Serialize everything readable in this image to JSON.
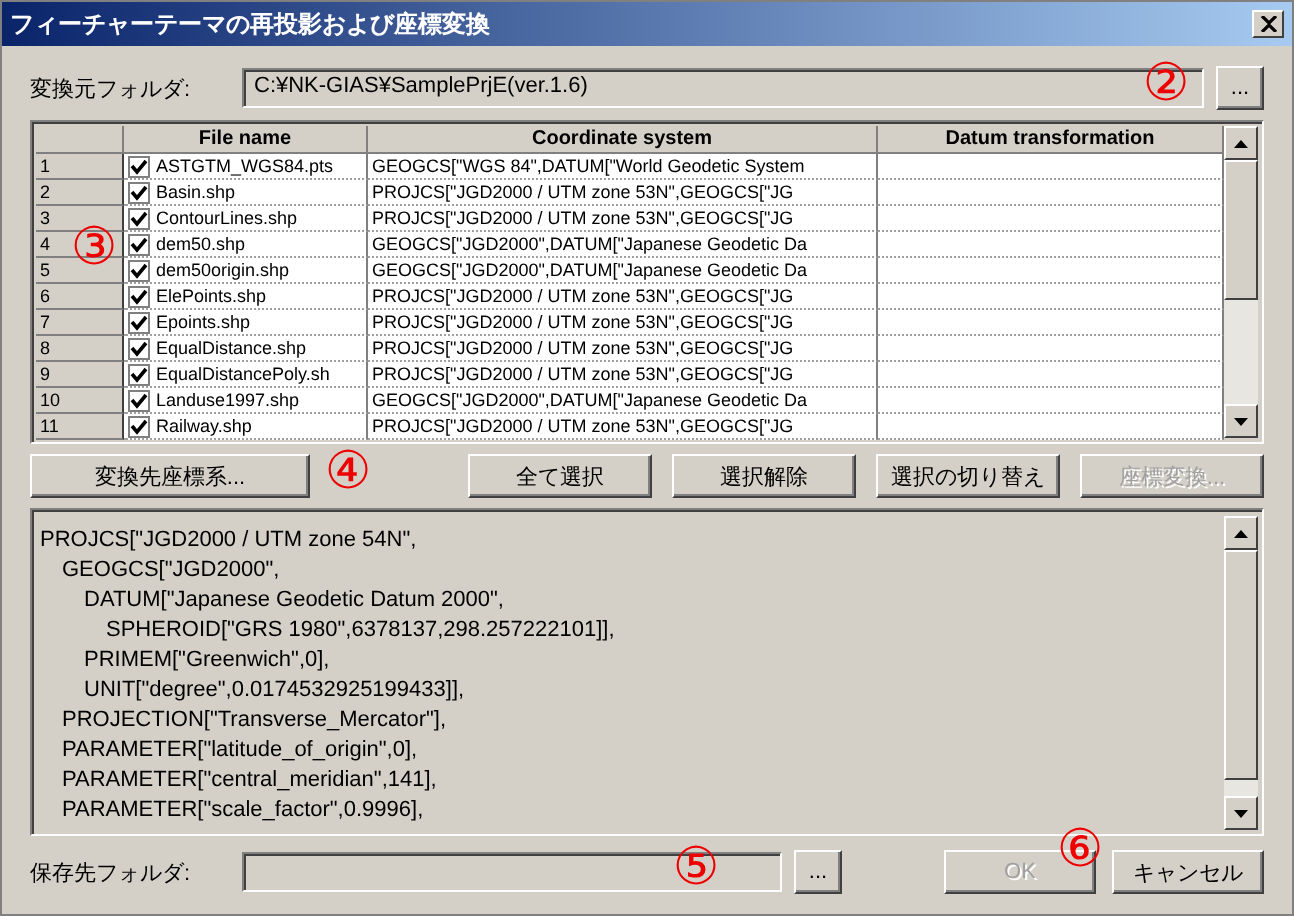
{
  "window": {
    "title": "フィーチャーテーマの再投影および座標変換"
  },
  "source_folder": {
    "label": "変換元フォルダ:",
    "value": "C:¥NK-GIAS¥SamplePrjE(ver.1.6)",
    "browse": "...",
    "callout": "②"
  },
  "table": {
    "callout": "③",
    "columns": [
      "File name",
      "Coordinate system",
      "Datum transformation"
    ],
    "rows": [
      {
        "number": "1",
        "checked": true,
        "file": "ASTGTM_WGS84.pts",
        "coord": "GEOGCS[\"WGS 84\",DATUM[\"World Geodetic System"
      },
      {
        "number": "2",
        "checked": true,
        "file": "Basin.shp",
        "coord": "PROJCS[\"JGD2000 / UTM zone 53N\",GEOGCS[\"JG"
      },
      {
        "number": "3",
        "checked": true,
        "file": "ContourLines.shp",
        "coord": "PROJCS[\"JGD2000 / UTM zone 53N\",GEOGCS[\"JG"
      },
      {
        "number": "4",
        "checked": true,
        "file": "dem50.shp",
        "coord": "GEOGCS[\"JGD2000\",DATUM[\"Japanese Geodetic Da"
      },
      {
        "number": "5",
        "checked": true,
        "file": "dem50origin.shp",
        "coord": "GEOGCS[\"JGD2000\",DATUM[\"Japanese Geodetic Da"
      },
      {
        "number": "6",
        "checked": true,
        "file": "ElePoints.shp",
        "coord": "PROJCS[\"JGD2000 / UTM zone 53N\",GEOGCS[\"JG"
      },
      {
        "number": "7",
        "checked": true,
        "file": "Epoints.shp",
        "coord": "PROJCS[\"JGD2000 / UTM zone 53N\",GEOGCS[\"JG"
      },
      {
        "number": "8",
        "checked": true,
        "file": "EqualDistance.shp",
        "coord": "PROJCS[\"JGD2000 / UTM zone 53N\",GEOGCS[\"JG"
      },
      {
        "number": "9",
        "checked": true,
        "file": "EqualDistancePoly.sh",
        "coord": "PROJCS[\"JGD2000 / UTM zone 53N\",GEOGCS[\"JG"
      },
      {
        "number": "10",
        "checked": true,
        "file": "Landuse1997.shp",
        "coord": "GEOGCS[\"JGD2000\",DATUM[\"Japanese Geodetic Da"
      },
      {
        "number": "11",
        "checked": true,
        "file": "Railway.shp",
        "coord": "PROJCS[\"JGD2000 / UTM zone 53N\",GEOGCS[\"JG"
      }
    ]
  },
  "buttons": {
    "callout": "④",
    "items": [
      {
        "label": "変換先座標系...",
        "disabled": false
      },
      {
        "label": "全て選択",
        "disabled": false
      },
      {
        "label": "選択解除",
        "disabled": false
      },
      {
        "label": "選択の切り替え",
        "disabled": false
      },
      {
        "label": "座標変換...",
        "disabled": true
      }
    ]
  },
  "wkt": [
    {
      "text": "PROJCS[\"JGD2000 / UTM zone 54N\",",
      "children": [
        {
          "text": "GEOGCS[\"JGD2000\",",
          "children": [
            {
              "text": "DATUM[\"Japanese Geodetic Datum 2000\",",
              "children": [
                {
                  "text": "SPHEROID[\"GRS 1980\",6378137,298.257222101]],"
                }
              ]
            },
            {
              "text": "PRIMEM[\"Greenwich\",0],"
            },
            {
              "text": "UNIT[\"degree\",0.0174532925199433]],"
            }
          ]
        },
        {
          "text": "PROJECTION[\"Transverse_Mercator\"],"
        },
        {
          "text": "PARAMETER[\"latitude_of_origin\",0],"
        },
        {
          "text": "PARAMETER[\"central_meridian\",141],"
        },
        {
          "text": "PARAMETER[\"scale_factor\",0.9996],"
        }
      ]
    }
  ],
  "save_folder": {
    "label": "保存先フォルダ:",
    "browse": "...",
    "callout": "⑤"
  },
  "footer": {
    "callout": "⑥",
    "ok": {
      "label": "OK",
      "disabled": true
    },
    "cancel": {
      "label": "キャンセル",
      "disabled": false
    }
  }
}
